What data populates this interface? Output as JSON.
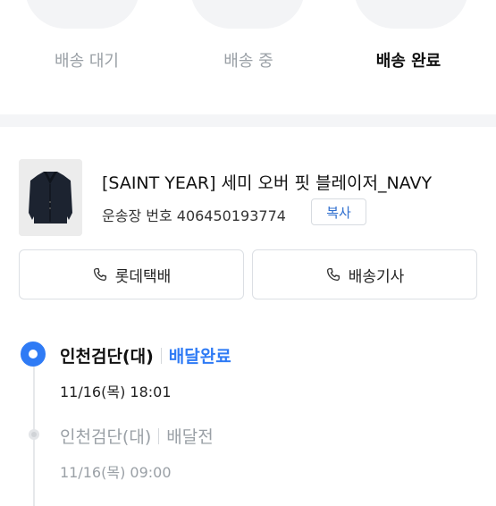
{
  "tabs": [
    {
      "label": "배송 대기",
      "active": false
    },
    {
      "label": "배송 중",
      "active": false
    },
    {
      "label": "배송 완료",
      "active": true
    }
  ],
  "product": {
    "title": "[SAINT YEAR] 세미 오버 핏 블레이저_NAVY",
    "tracking_label": "운송장 번호 406450193774",
    "copy_label": "복사"
  },
  "actions": {
    "courier_label": "롯데택배",
    "driver_label": "배송기사",
    "icon": "phone-icon"
  },
  "timeline": [
    {
      "location": "인천검단(대)",
      "status": "배달완료",
      "time": "11/16(목) 18:01",
      "current": true
    },
    {
      "location": "인천검단(대)",
      "status": "배달전",
      "time": "11/16(목) 09:00",
      "current": false
    }
  ],
  "colors": {
    "accent": "#2f7bf5",
    "copy_text": "#2f6fcf",
    "muted": "#9aa0a6"
  }
}
